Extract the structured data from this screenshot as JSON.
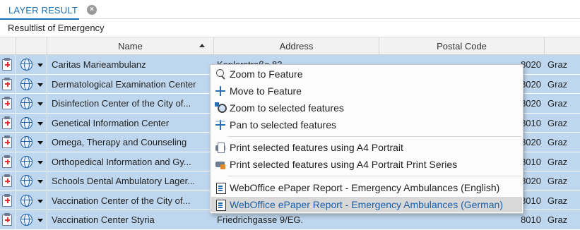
{
  "tab": {
    "label": "LAYER RESULT",
    "close_glyph": "×"
  },
  "subtitle": "Resultlist of Emergency",
  "columns": {
    "name": "Name",
    "address": "Address",
    "postal": "Postal Code"
  },
  "rows": [
    {
      "name": "Caritas Marieambulanz",
      "address": "Keplerstraße 82",
      "postal": "8020",
      "city": "Graz"
    },
    {
      "name": "Dermatological Examination Center",
      "address": "",
      "postal": "8020",
      "city": "Graz"
    },
    {
      "name": "Disinfection Center of the City of...",
      "address": "",
      "postal": "8020",
      "city": "Graz"
    },
    {
      "name": "Genetical Information Center",
      "address": "",
      "postal": "8010",
      "city": "Graz"
    },
    {
      "name": "Omega, Therapy and Counseling",
      "address": "",
      "postal": "8020",
      "city": "Graz"
    },
    {
      "name": "Orthopedical Information and Gy...",
      "address": "",
      "postal": "8010",
      "city": "Graz"
    },
    {
      "name": "Schools Dental Ambulatory Lager...",
      "address": "",
      "postal": "8020",
      "city": "Graz"
    },
    {
      "name": "Vaccination Center of the City of...",
      "address": "",
      "postal": "8010",
      "city": "Graz"
    },
    {
      "name": "Vaccination Center Styria",
      "address": "Friedrichgasse 9/EG.",
      "postal": "8010",
      "city": "Graz"
    }
  ],
  "context_menu": {
    "zoom_feature": "Zoom to Feature",
    "move_feature": "Move to Feature",
    "zoom_selected": "Zoom to selected features",
    "pan_selected": "Pan to selected features",
    "print_a4": "Print selected features using A4 Portrait",
    "print_a4_series": "Print selected features using A4 Portrait Print Series",
    "epaper_english": "WebOffice ePaper Report - Emergency Ambulances (English)",
    "epaper_german": "WebOffice ePaper Report - Emergency Ambulances (German)"
  },
  "colors": {
    "accent": "#1a6fb5",
    "row_selected": "#bfd7ee",
    "menu_highlight": "#d8d8d8"
  }
}
